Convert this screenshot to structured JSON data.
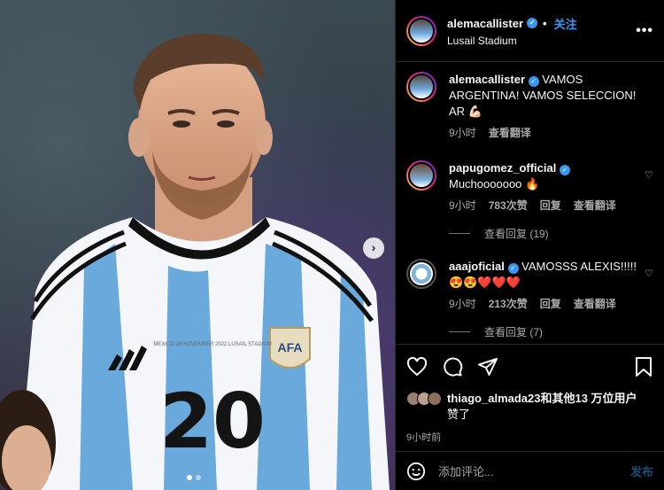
{
  "post": {
    "username": "alemacallister",
    "separator": "•",
    "follow_label": "关注",
    "location": "Lusail Stadium",
    "more_label": "•••",
    "photo_next_label": "›",
    "jersey_number": "20",
    "jersey_text": "MEXICO 26 NOVEMBER 2022 LUSAIL STADIUM",
    "badge_text": "AFA"
  },
  "comments": [
    {
      "username": "alemacallister",
      "text": "VAMOS ARGENTINA! VAMOS SELECCION! AR 💪🏻",
      "time": "9小时",
      "translate": "查看翻译"
    },
    {
      "username": "papugomez_official",
      "text": "Muchooooooo 🔥",
      "time": "9小时",
      "likes": "783次赞",
      "reply": "回复",
      "translate": "查看翻译",
      "view_replies": "查看回复 (19)"
    },
    {
      "username": "aaajoficial",
      "text": "VAMOSSS ALEXIS!!!!! 😍😍❤️❤️❤️",
      "time": "9小时",
      "likes": "213次赞",
      "reply": "回复",
      "translate": "查看翻译",
      "view_replies": "查看回复 (7)"
    }
  ],
  "likes_summary": {
    "text_line1": "thiago_almada23和其他13 万位用户",
    "text_line2": "赞了"
  },
  "post_time": "9小时前",
  "add_comment": {
    "placeholder": "添加评论...",
    "post_label": "发布"
  },
  "icons": [
    "heart-icon",
    "comment-icon",
    "share-icon",
    "bookmark-icon",
    "emoji-icon",
    "verified-icon",
    "more-icon"
  ],
  "colors": {
    "accent": "#3897f0",
    "background": "#000000",
    "muted": "#a8a8a8"
  }
}
